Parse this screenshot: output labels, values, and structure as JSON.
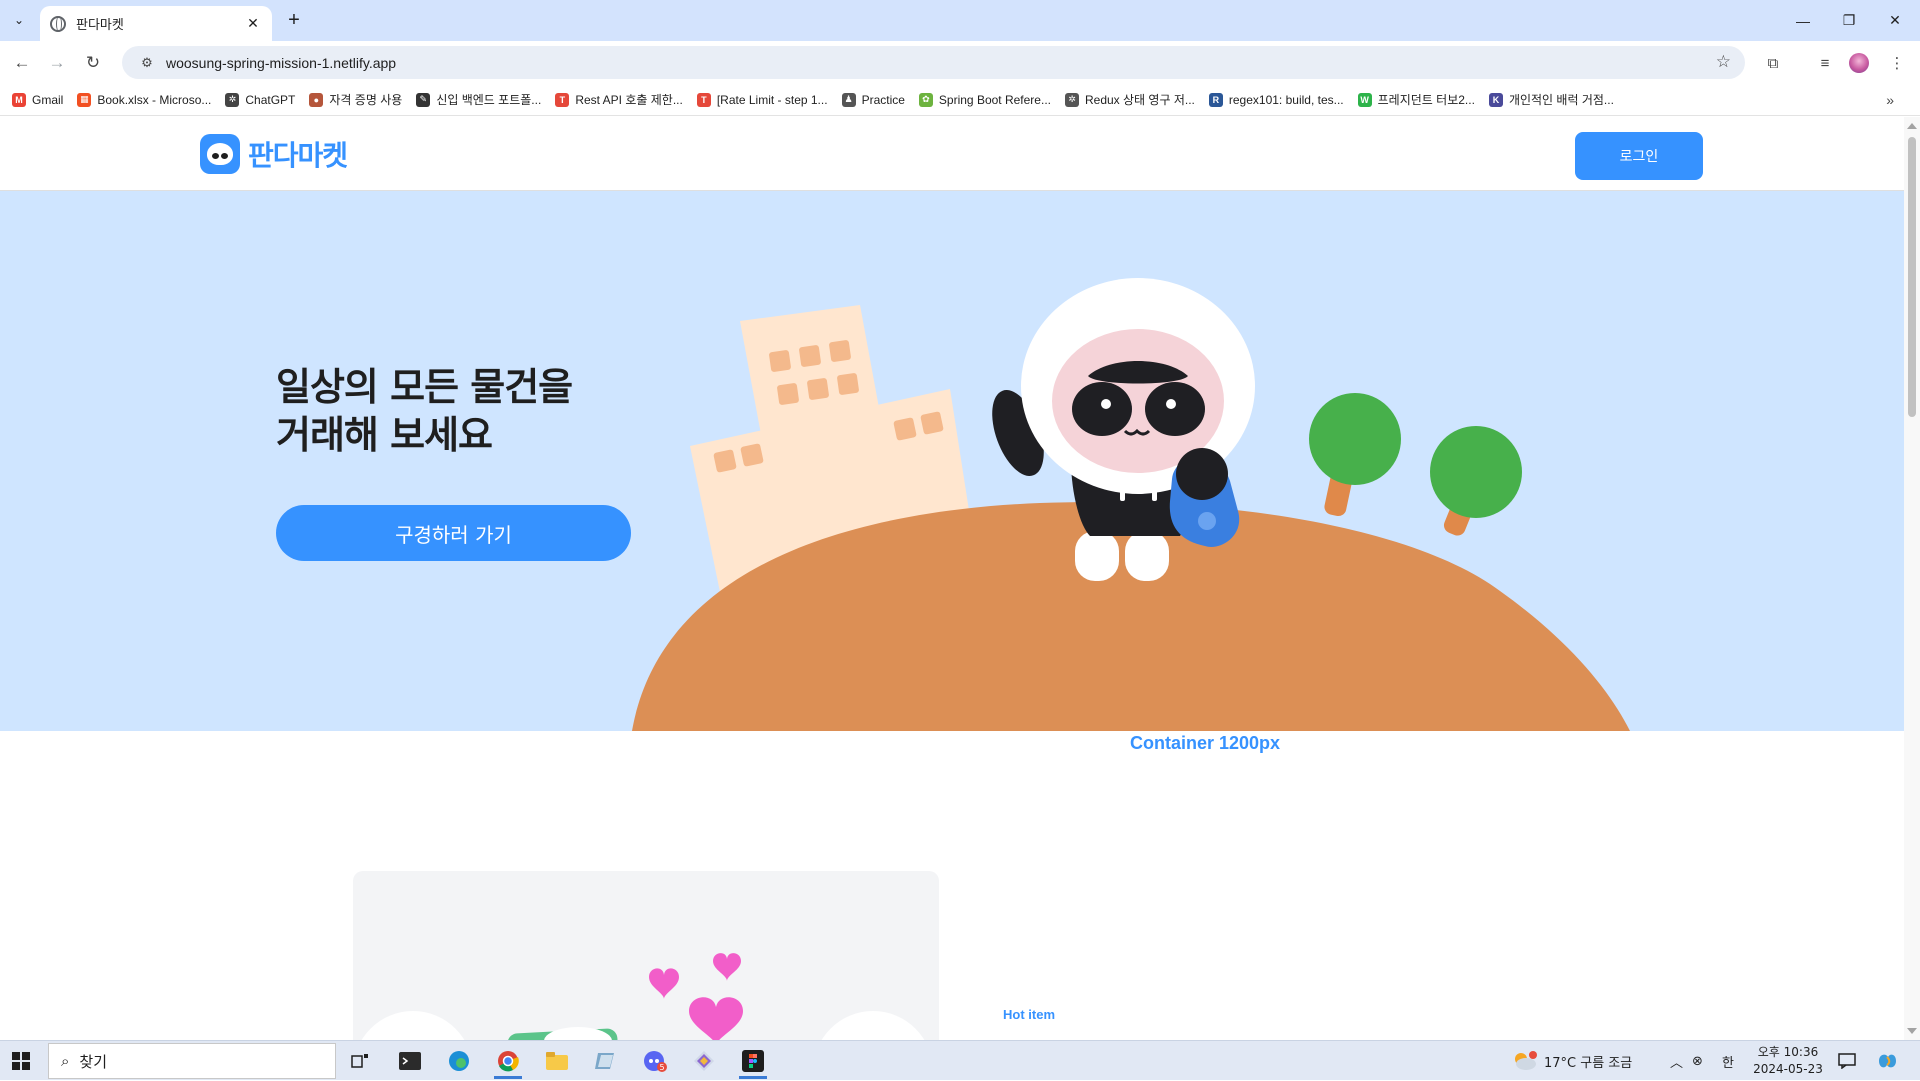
{
  "browser": {
    "tab_title": "판다마켓",
    "url": "woosung-spring-mission-1.netlify.app",
    "bookmarks": [
      {
        "label": "Gmail",
        "color": "#ea4335",
        "glyph": "M"
      },
      {
        "label": "Book.xlsx - Microso...",
        "color": "#f25022",
        "glyph": "▦"
      },
      {
        "label": "ChatGPT",
        "color": "#444444",
        "glyph": "✲"
      },
      {
        "label": "자격 증명 사용",
        "color": "#b5563b",
        "glyph": "●"
      },
      {
        "label": "신입 백엔드 포트폴...",
        "color": "#333333",
        "glyph": "✎"
      },
      {
        "label": "Rest API 호출 제한...",
        "color": "#e5483a",
        "glyph": "T"
      },
      {
        "label": "[Rate Limit - step 1...",
        "color": "#e5483a",
        "glyph": "T"
      },
      {
        "label": "Practice",
        "color": "#555555",
        "glyph": "♟"
      },
      {
        "label": "Spring Boot Refere...",
        "color": "#6db33f",
        "glyph": "✿"
      },
      {
        "label": "Redux 상태 영구 저...",
        "color": "#555555",
        "glyph": "✲"
      },
      {
        "label": "regex101: build, tes...",
        "color": "#2b5797",
        "glyph": "R"
      },
      {
        "label": "프레지던트 터보2...",
        "color": "#2db34a",
        "glyph": "W"
      },
      {
        "label": "개인적인 배럭 거점...",
        "color": "#4a4a9a",
        "glyph": "K"
      }
    ]
  },
  "site": {
    "logo_text": "판다마켓",
    "login_label": "로그인",
    "hero": {
      "title_line1": "일상의 모든 물건을",
      "title_line2": "거래해 보세요",
      "cta_label": "구경하러 가기"
    },
    "container_label": "Container 1200px",
    "hot_item_label": "Hot item"
  },
  "taskbar": {
    "search_placeholder": "찾기",
    "weather": "17°C  구름 조금",
    "ime": "한",
    "time": "오후 10:36",
    "date": "2024-05-23"
  },
  "colors": {
    "brand": "#3692ff",
    "hero_bg": "#cfe5ff",
    "hill": "#dc8f55"
  }
}
